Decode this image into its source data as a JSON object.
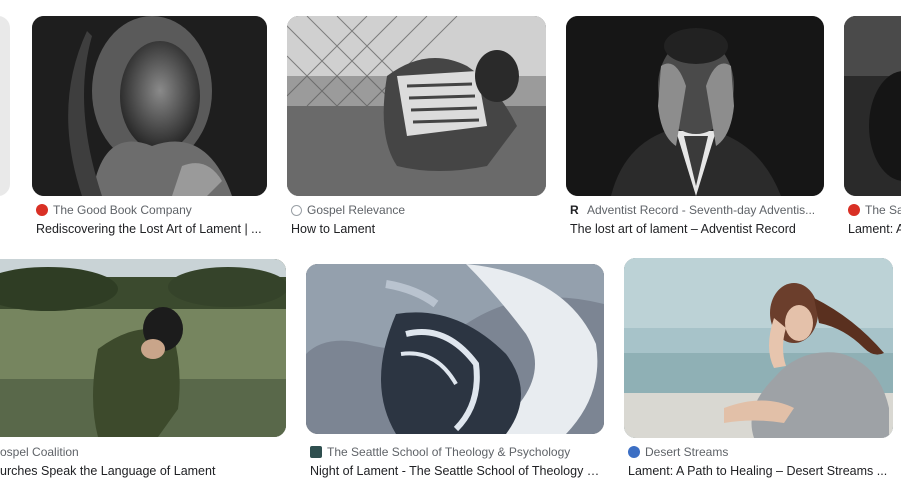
{
  "results": [
    {
      "source": "",
      "title": ""
    },
    {
      "source": "The Good Book Company",
      "title": "Rediscovering the Lost Art of Lament | ...",
      "favicon": "red-shield-check-icon",
      "color": "#d93025"
    },
    {
      "source": "Gospel Relevance",
      "title": "How to Lament",
      "favicon": "circle-g-icon",
      "color": "#9aa0a6"
    },
    {
      "source": "Adventist Record - Seventh-day Adventis...",
      "title": "The lost art of lament – Adventist Record",
      "favicon": "r-logo-icon",
      "color": "#202124"
    },
    {
      "source": "The Sa",
      "title": "Lament: A",
      "favicon": "red-shield-icon",
      "color": "#d93025"
    },
    {
      "source": "ospel Coalition",
      "title": "urches Speak the Language of Lament"
    },
    {
      "source": "The Seattle School of Theology & Psychology",
      "title": "Night of Lament - The Seattle School of Theology & ...",
      "favicon": "seattle-school-icon",
      "color": "#2f4f4f"
    },
    {
      "source": "Desert Streams",
      "title": "Lament: A Path to Healing – Desert Streams ...",
      "favicon": "wordpress-icon",
      "color": "#3c6fc4"
    }
  ]
}
